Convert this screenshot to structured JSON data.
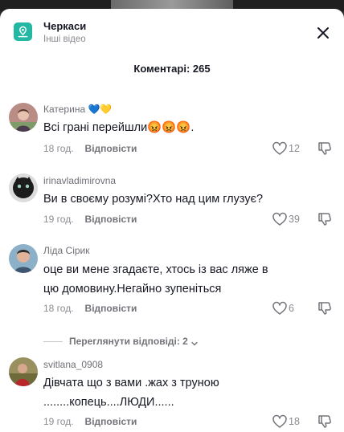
{
  "location": {
    "title": "Черкаси",
    "subtitle": "Інші відео"
  },
  "comments_count_label": "Коментарі: 265",
  "comments": [
    {
      "author": "Катерина 💙💛",
      "text": "Всі грані перейшли😡😡😡.",
      "time": "18 год.",
      "reply_label": "Відповісти",
      "likes": "12"
    },
    {
      "author": "irinavladimirovna",
      "text": "Ви в своєму розумі?Хто над цим глузує?",
      "time": "19 год.",
      "reply_label": "Відповісти",
      "likes": "39"
    },
    {
      "author": "Ліда Сірик",
      "text": "оце ви мене згадаєте, хтось із вас ляже в цю домовину.Негайно зупеніться",
      "time": "18 год.",
      "reply_label": "Відповісти",
      "likes": "6",
      "view_replies_label": "Переглянути відповіді: 2"
    },
    {
      "author": "svitlana_0908",
      "text": "Дівчата що з вами .жах з труною ........копець....ЛЮДИ......",
      "time": "19 год.",
      "reply_label": "Відповісти",
      "likes": "18"
    }
  ],
  "icons": {
    "location": "location-pin-icon",
    "close": "close-icon",
    "like": "heart-outline-icon",
    "dislike": "thumbs-down-icon",
    "expand": "chevron-down-icon"
  },
  "colors": {
    "accent": "#22b8a4",
    "text": "#161823",
    "muted": "#8a8b91"
  }
}
